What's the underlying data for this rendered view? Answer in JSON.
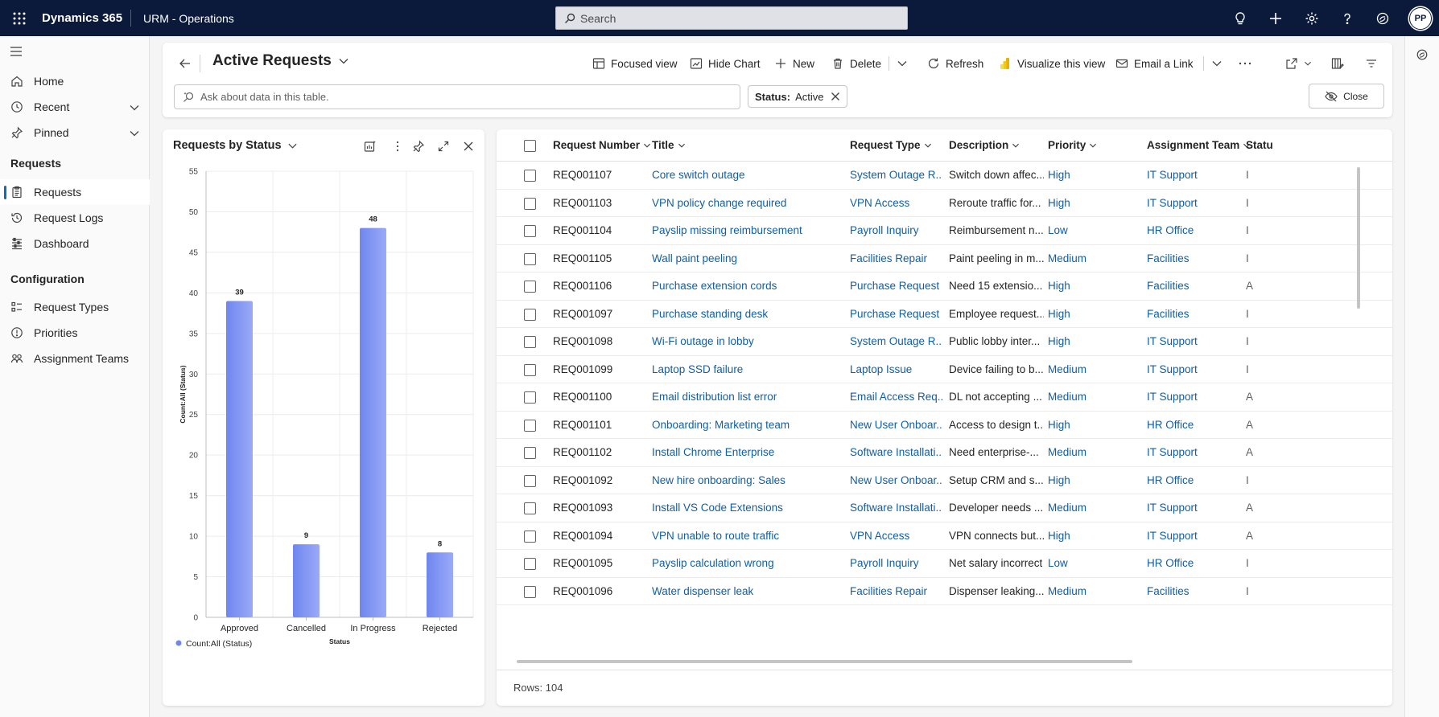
{
  "topbar": {
    "app_name": "Dynamics 365",
    "app_sub": "URM - Operations",
    "search_placeholder": "Search",
    "avatar_initials": "PP"
  },
  "nav": {
    "home": "Home",
    "recent": "Recent",
    "pinned": "Pinned",
    "group_requests": "Requests",
    "requests": "Requests",
    "request_logs": "Request Logs",
    "dashboard": "Dashboard",
    "group_config": "Configuration",
    "request_types": "Request Types",
    "priorities": "Priorities",
    "assignment_teams": "Assignment Teams"
  },
  "header": {
    "view_title": "Active Requests",
    "cmd_focused": "Focused view",
    "cmd_hide_chart": "Hide Chart",
    "cmd_new": "New",
    "cmd_delete": "Delete",
    "cmd_refresh": "Refresh",
    "cmd_visualize": "Visualize this view",
    "cmd_email": "Email a Link",
    "ask_placeholder": "Ask about data in this table.",
    "filter_label": "Status:",
    "filter_value": "Active",
    "close_label": "Close"
  },
  "chart_title": "Requests by Status",
  "chart_data": {
    "type": "bar",
    "categories": [
      "Approved",
      "Cancelled",
      "In Progress",
      "Rejected"
    ],
    "values": [
      39,
      9,
      48,
      8
    ],
    "xlabel": "Status",
    "ylabel": "Count:All (Status)",
    "ylim": [
      0,
      55
    ],
    "yticks": [
      0,
      5,
      10,
      15,
      20,
      25,
      30,
      35,
      40,
      45,
      50,
      55
    ],
    "legend": "Count:All (Status)",
    "legend_position": "bottom-left",
    "grid": true,
    "color": "#6f86f0"
  },
  "grid": {
    "columns": [
      "Request Number",
      "Title",
      "Request Type",
      "Description",
      "Priority",
      "Assignment Team",
      "Statu"
    ],
    "rows": [
      [
        "REQ001107",
        "Core switch outage",
        "System Outage R...",
        "Switch down affec...",
        "High",
        "IT Support",
        "I"
      ],
      [
        "REQ001103",
        "VPN policy change required",
        "VPN Access",
        "Reroute traffic for...",
        "High",
        "IT Support",
        "I"
      ],
      [
        "REQ001104",
        "Payslip missing reimbursement",
        "Payroll Inquiry",
        "Reimbursement n...",
        "Low",
        "HR Office",
        "I"
      ],
      [
        "REQ001105",
        "Wall paint peeling",
        "Facilities Repair",
        "Paint peeling in m...",
        "Medium",
        "Facilities",
        "I"
      ],
      [
        "REQ001106",
        "Purchase extension cords",
        "Purchase Request",
        "Need 15 extensio...",
        "High",
        "Facilities",
        "A"
      ],
      [
        "REQ001097",
        "Purchase standing desk",
        "Purchase Request",
        "Employee request...",
        "High",
        "Facilities",
        "I"
      ],
      [
        "REQ001098",
        "Wi-Fi outage in lobby",
        "System Outage R...",
        "Public lobby inter...",
        "High",
        "IT Support",
        "I"
      ],
      [
        "REQ001099",
        "Laptop SSD failure",
        "Laptop Issue",
        "Device failing to b...",
        "Medium",
        "IT Support",
        "I"
      ],
      [
        "REQ001100",
        "Email distribution list error",
        "Email Access Req...",
        "DL not accepting ...",
        "Medium",
        "IT Support",
        "A"
      ],
      [
        "REQ001101",
        "Onboarding: Marketing team",
        "New User Onboar...",
        "Access to design t...",
        "High",
        "HR Office",
        "A"
      ],
      [
        "REQ001102",
        "Install Chrome Enterprise",
        "Software Installati...",
        "Need enterprise-...",
        "Medium",
        "IT Support",
        "A"
      ],
      [
        "REQ001092",
        "New hire onboarding: Sales",
        "New User Onboar...",
        "Setup CRM and s...",
        "High",
        "HR Office",
        "I"
      ],
      [
        "REQ001093",
        "Install VS Code Extensions",
        "Software Installati...",
        "Developer needs ...",
        "Medium",
        "IT Support",
        "A"
      ],
      [
        "REQ001094",
        "VPN unable to route traffic",
        "VPN Access",
        "VPN connects but...",
        "High",
        "IT Support",
        "A"
      ],
      [
        "REQ001095",
        "Payslip calculation wrong",
        "Payroll Inquiry",
        "Net salary incorrect",
        "Low",
        "HR Office",
        "I"
      ],
      [
        "REQ001096",
        "Water dispenser leak",
        "Facilities Repair",
        "Dispenser leaking...",
        "Medium",
        "Facilities",
        "I"
      ]
    ],
    "rows_count": "Rows: 104"
  }
}
